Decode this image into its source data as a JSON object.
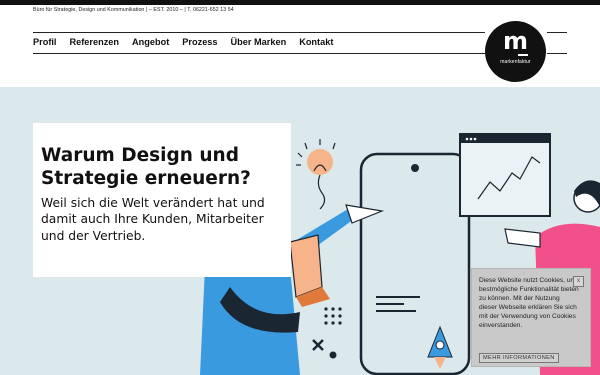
{
  "header": {
    "tagline": "Büro für Strategie, Design und Kommunikation | – EST. 2010 – | T. 06221-652 13 54",
    "logo": {
      "mark": "m",
      "word": "markenfaktur"
    }
  },
  "nav": {
    "items": [
      {
        "label": "Profil"
      },
      {
        "label": "Referenzen"
      },
      {
        "label": "Angebot"
      },
      {
        "label": "Prozess"
      },
      {
        "label": "Über Marken"
      },
      {
        "label": "Kontakt"
      }
    ]
  },
  "hero": {
    "title": "Warum Design und Strategie erneuern?",
    "subtitle": "Weil sich die Welt verändert hat und damit auch Ihre Kunden, Mitarbeiter und der Vertrieb."
  },
  "cookie": {
    "text": "Diese Website nutzt Cookies, um bestmögliche Funktionalität bieten zu können. Mit der Nutzung dieser Webseite erklären Sie sich mit der Verwendung von Cookies einverstanden.",
    "close_label": "x",
    "more_label": "MEHR INFORMATIONEN"
  },
  "colors": {
    "hero_bg": "#dbe9ed",
    "accent_pink": "#f2508a",
    "accent_blue": "#3a9ae0",
    "bulb_orange": "#f7b48a",
    "dark": "#111111"
  }
}
